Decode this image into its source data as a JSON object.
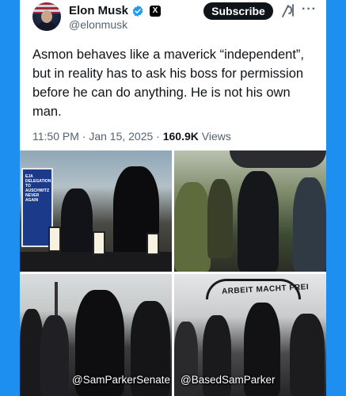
{
  "author": {
    "name": "Elon Musk",
    "handle": "@elonmusk",
    "verified_icon": "verified-badge-icon",
    "affiliate_badge": "X"
  },
  "header": {
    "subscribe_label": "Subscribe",
    "grok_icon": "grok-icon",
    "more_icon": "···"
  },
  "tweet": {
    "text": "Asmon behaves like a maverick “independent”, but in reality has to ask his boss for permission before he can do anything. He is not his own man.",
    "time": "11:50 PM · Jan 15, 2025 · ",
    "views_count": "160.9K",
    "views_label": " Views"
  },
  "media": {
    "sign_text": "EJA DELEGATION TO AUSCHWITZ NEVER AGAIN",
    "gate_text": "ARBEIT MACHT FREI",
    "watermark_left": "@SamParkerSenate",
    "watermark_right": "@BasedSamParker"
  },
  "colors": {
    "page_background": "#1d8ff0",
    "text_primary": "#0f1419",
    "text_secondary": "#536471",
    "verified_blue": "#1d9bf0"
  }
}
